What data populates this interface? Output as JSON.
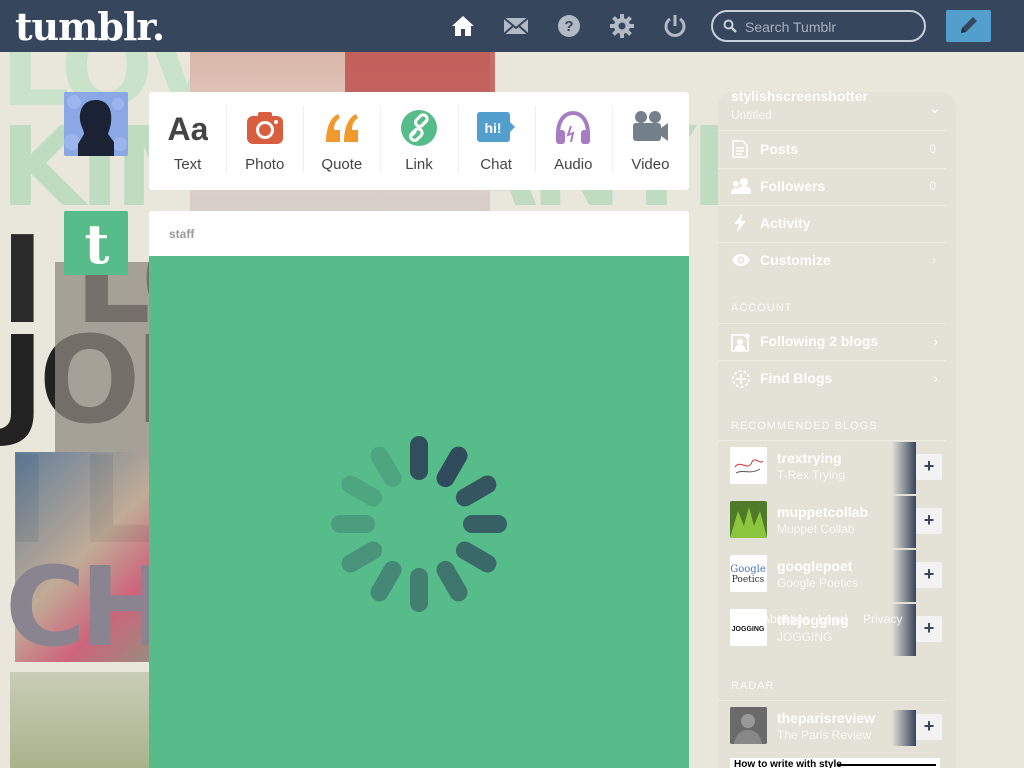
{
  "header": {
    "logo": "tumblr.",
    "search_placeholder": "Search Tumblr",
    "nav_icons": [
      "home-icon",
      "mail-icon",
      "help-icon",
      "settings-icon",
      "power-icon"
    ],
    "compose_icon": "pencil-icon",
    "colors": {
      "bar": "#36465d",
      "compose": "#529ecc"
    }
  },
  "post_types": [
    {
      "label": "Text",
      "icon": "text-icon",
      "color": "#444444"
    },
    {
      "label": "Photo",
      "icon": "camera-icon",
      "color": "#d95e40"
    },
    {
      "label": "Quote",
      "icon": "quote-icon",
      "color": "#f2992e"
    },
    {
      "label": "Link",
      "icon": "link-icon",
      "color": "#56bc8a"
    },
    {
      "label": "Chat",
      "icon": "chat-icon",
      "color": "#529ecc"
    },
    {
      "label": "Audio",
      "icon": "headphones-icon",
      "color": "#a77dc2"
    },
    {
      "label": "Video",
      "icon": "video-camera-icon",
      "color": "#748089"
    }
  ],
  "post": {
    "author": "staff",
    "media_color": "#56bc8a",
    "state": "loading"
  },
  "sidebar": {
    "blog_name": "stylishscreenshotter",
    "blog_subtitle": "Untitled",
    "rows": [
      {
        "label": "Posts",
        "count": "0",
        "icon": "posts-icon"
      },
      {
        "label": "Followers",
        "count": "0",
        "icon": "followers-icon"
      },
      {
        "label": "Activity",
        "count": "",
        "icon": "activity-icon"
      },
      {
        "label": "Customize",
        "count": "›",
        "icon": "eye-icon"
      }
    ],
    "account_heading": "ACCOUNT",
    "account_rows": [
      {
        "label": "Following 2 blogs",
        "icon": "following-icon"
      },
      {
        "label": "Find Blogs",
        "icon": "find-blogs-icon"
      }
    ],
    "recommended_heading": "RECOMMENDED BLOGS",
    "recommended": [
      {
        "name": "trextrying",
        "title": "T-Rex Trying"
      },
      {
        "name": "muppetcollab",
        "title": "Muppet Collab"
      },
      {
        "name": "googlepoet",
        "title": "Google Poetics"
      },
      {
        "name": "thejogging",
        "title": "JOGGING"
      }
    ],
    "footer_overlay": [
      "About",
      "Apps",
      "Legal",
      "Privacy"
    ],
    "radar_heading": "RADAR",
    "radar": [
      {
        "name": "theparisreview",
        "title": "The Paris Review"
      }
    ],
    "radar_post_headline": "How to write with style"
  }
}
